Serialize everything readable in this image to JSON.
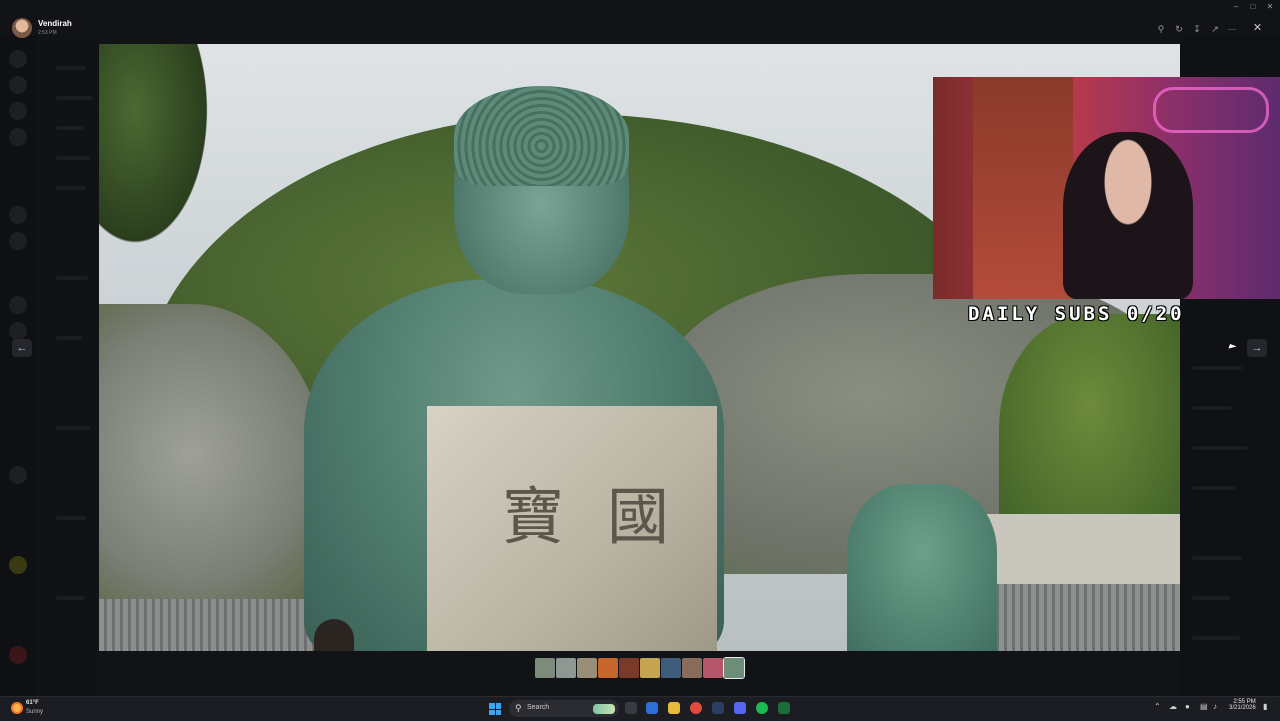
{
  "viewer": {
    "username": "Vendirah",
    "time": "2:53 PM"
  },
  "webcam": {
    "overlay_text": "DAILY SUBS 0/20"
  },
  "image": {
    "stone_chars": [
      "寶",
      "國"
    ]
  },
  "taskbar": {
    "weather_temp": "61°F",
    "weather_desc": "Sunny",
    "search_label": "Search",
    "clock_time": "2:55 PM",
    "clock_date": "3/21/2026"
  },
  "colors": {
    "taskbar_bg": "#1c1d22",
    "accent_start": "#3ea4f0",
    "spotify": "#1db954"
  },
  "icons": {
    "zoom": "zoom-icon",
    "rotate": "rotate-icon",
    "download": "download-icon",
    "open_external": "open-external-icon",
    "more": "more-icon",
    "close": "close-icon"
  }
}
